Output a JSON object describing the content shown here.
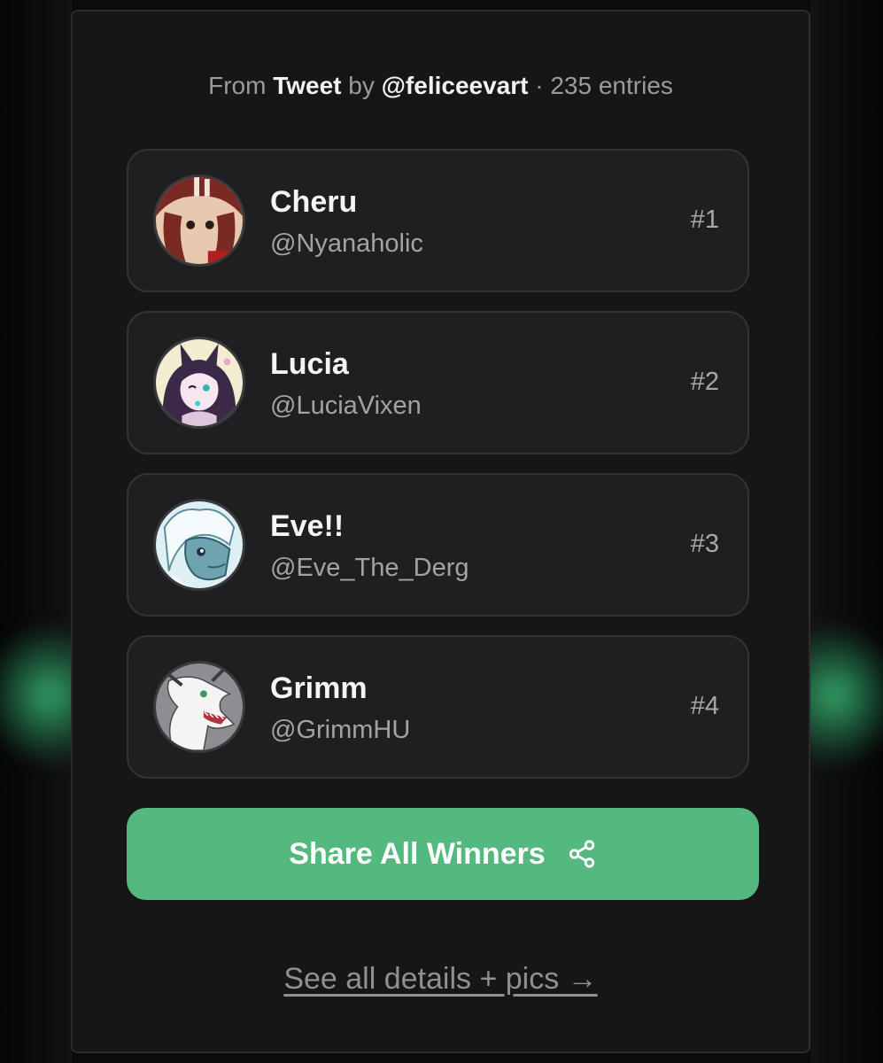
{
  "source": {
    "prefix": "From",
    "platform": "Tweet",
    "by": "by",
    "author": "@feliceevart",
    "separator": "·",
    "entries": "235 entries"
  },
  "winners": [
    {
      "name": "Cheru",
      "handle": "@Nyanaholic",
      "rank": "#1",
      "avatar_icon": "avatar-icon",
      "avatar_color": "#7a2a22"
    },
    {
      "name": "Lucia",
      "handle": "@LuciaVixen",
      "rank": "#2",
      "avatar_icon": "avatar-icon",
      "avatar_color": "#3a2a48"
    },
    {
      "name": "Eve!!",
      "handle": "@Eve_The_Derg",
      "rank": "#3",
      "avatar_icon": "avatar-icon",
      "avatar_color": "#6fa3b0"
    },
    {
      "name": "Grimm",
      "handle": "@GrimmHU",
      "rank": "#4",
      "avatar_icon": "avatar-icon",
      "avatar_color": "#9a9a9e"
    }
  ],
  "share_button": {
    "label": "Share All Winners",
    "icon": "share-icon"
  },
  "details_link": {
    "label": "See all details + pics →"
  },
  "colors": {
    "background": "#0b0b0c",
    "card": "#161617",
    "row": "#1f1f21",
    "accent": "#54b97e",
    "glow": "#3cbe78"
  }
}
